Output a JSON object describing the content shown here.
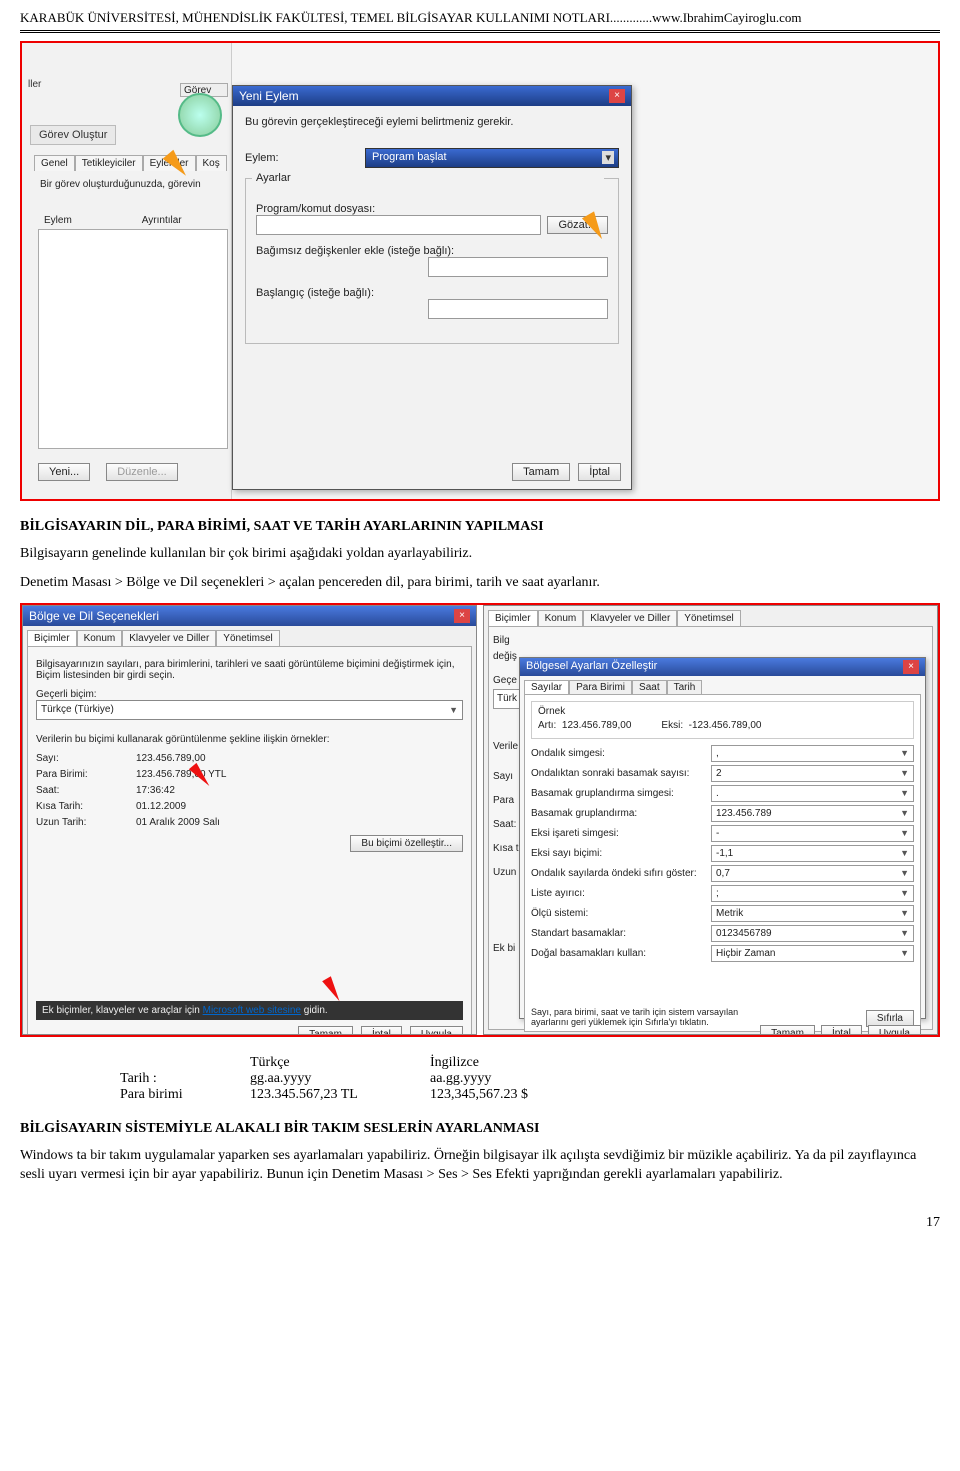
{
  "header": "KARABÜK ÜNİVERSİTESİ, MÜHENDİSLİK FAKÜLTESİ, TEMEL BİLGİSAYAR KULLANIMI NOTLARI.............www.IbrahimCayiroglu.com",
  "top_shot": {
    "left_label": "ller",
    "gorev_tab": "Görev",
    "gorev_olustur": "Görev Oluştur",
    "back_tabs": [
      "Genel",
      "Tetikleyiciler",
      "Eylemler",
      "Koş"
    ],
    "back_desc": "Bir görev oluşturduğunuzda, görevin",
    "eylem_col": "Eylem",
    "ayrinti_col": "Ayrıntılar",
    "yeni_btn": "Yeni...",
    "duzenle_btn": "Düzenle...",
    "dialog": {
      "title": "Yeni Eylem",
      "desc": "Bu görevin gerçekleştireceği eylemi belirtmeniz gerekir.",
      "eylem_label": "Eylem:",
      "eylem_value": "Program başlat",
      "ayarlar": "Ayarlar",
      "prog_label": "Program/komut dosyası:",
      "gozat": "Gözat...",
      "bagimsiz": "Bağımsız değişkenler ekle (isteğe bağlı):",
      "baslangic": "Başlangıç (isteğe bağlı):",
      "tamam": "Tamam",
      "iptal": "İptal"
    }
  },
  "section1_title": "BİLGİSAYARIN DİL, PARA BİRİMİ, SAAT VE TARİH AYARLARININ YAPILMASI",
  "para1": "Bilgisayarın genelinde kullanılan bir çok birimi aşağıdaki yoldan ayarlayabiliriz.",
  "para2": "Denetim Masası > Bölge ve Dil seçenekleri > açalan pencereden dil, para birimi, tarih ve saat ayarlanır.",
  "region_left": {
    "title": "Bölge ve Dil Seçenekleri",
    "tabs": [
      "Biçimler",
      "Konum",
      "Klavyeler ve Diller",
      "Yönetimsel"
    ],
    "desc": "Bilgisayarınızın sayıları, para birimlerini, tarihleri ve saati görüntüleme biçimini değiştirmek için, Biçim listesinden bir girdi seçin.",
    "gecerli": "Geçerli biçim:",
    "combo": "Türkçe (Türkiye)",
    "examples_title": "Verilerin bu biçimi kullanarak görüntülenme şekline ilişkin örnekler:",
    "rows": [
      {
        "lab": "Sayı:",
        "val": "123.456.789,00"
      },
      {
        "lab": "Para Birimi:",
        "val": "123.456.789,00 YTL"
      },
      {
        "lab": "Saat:",
        "val": "17:36:42"
      },
      {
        "lab": "Kısa Tarih:",
        "val": "01.12.2009"
      },
      {
        "lab": "Uzun Tarih:",
        "val": "01 Aralık 2009 Salı"
      }
    ],
    "ozel_btn": "Bu biçimi özelleştir...",
    "foot_text_a": "Ek biçimler, klavyeler ve araçlar için ",
    "foot_link": "Microsoft web sitesine",
    "foot_text_b": " gidin.",
    "tamam": "Tamam",
    "iptal": "İptal",
    "uygula": "Uygula"
  },
  "region_right": {
    "outer_tabs": [
      "Biçimler",
      "Konum",
      "Klavyeler ve Diller",
      "Yönetimsel"
    ],
    "bilg": "Bilg",
    "degis": "değiş",
    "gece": "Geçe",
    "turk": "Türk",
    "verile": "Verile",
    "list_left": [
      "Sayı",
      "Para",
      "Saat:",
      "Kısa t",
      "Uzun"
    ],
    "ekbi": "Ek bi",
    "inner_title": "Bölgesel Ayarları Özelleştir",
    "inner_tabs": [
      "Sayılar",
      "Para Birimi",
      "Saat",
      "Tarih"
    ],
    "ornek": "Örnek",
    "arti_lab": "Artı:",
    "arti_val": "123.456.789,00",
    "eksi_lab": "Eksi:",
    "eksi_val": "-123.456.789,00",
    "settings": [
      {
        "lab": "Ondalık simgesi:",
        "val": ","
      },
      {
        "lab": "Ondalıktan sonraki basamak sayısı:",
        "val": "2"
      },
      {
        "lab": "Basamak gruplandırma simgesi:",
        "val": "."
      },
      {
        "lab": "Basamak gruplandırma:",
        "val": "123.456.789"
      },
      {
        "lab": "Eksi işareti simgesi:",
        "val": "-"
      },
      {
        "lab": "Eksi sayı biçimi:",
        "val": "-1,1"
      },
      {
        "lab": "Ondalık sayılarda öndeki sıfırı göster:",
        "val": "0,7"
      },
      {
        "lab": "Liste ayırıcı:",
        "val": ";"
      },
      {
        "lab": "Ölçü sistemi:",
        "val": "Metrik"
      },
      {
        "lab": "Standart basamaklar:",
        "val": "0123456789"
      },
      {
        "lab": "Doğal basamakları kullan:",
        "val": "Hiçbir Zaman"
      }
    ],
    "note": "Sayı, para birimi, saat ve tarih için sistem varsayılan ayarlarını geri yüklemek için Sıfırla'yı tıklatın.",
    "sifirla": "Sıfırla",
    "tamam": "Tamam",
    "iptal": "İptal",
    "uygula": "Uygula"
  },
  "compare": {
    "h_tr": "Türkçe",
    "h_en": "İngilizce",
    "tarih_lab": "Tarih :",
    "tarih_tr": "gg.aa.yyyy",
    "tarih_en": "aa.gg.yyyy",
    "para_lab": "Para birimi",
    "para_tr": "123.345.567,23 TL",
    "para_en": "123,345,567.23 $"
  },
  "section2_title": "BİLGİSAYARIN SİSTEMİYLE ALAKALI BİR TAKIM SESLERİN AYARLANMASI",
  "para3": "Windows ta bir takım uygulamalar yaparken ses ayarlamaları yapabiliriz. Örneğin bilgisayar ilk açılışta sevdiğimiz bir müzikle açabiliriz. Ya da pil zayıflayınca sesli uyarı vermesi için bir ayar yapabiliriz. Bunun için Denetim Masası > Ses > Ses Efekti yaprığından gerekli ayarlamaları yapabiliriz.",
  "page_num": "17"
}
